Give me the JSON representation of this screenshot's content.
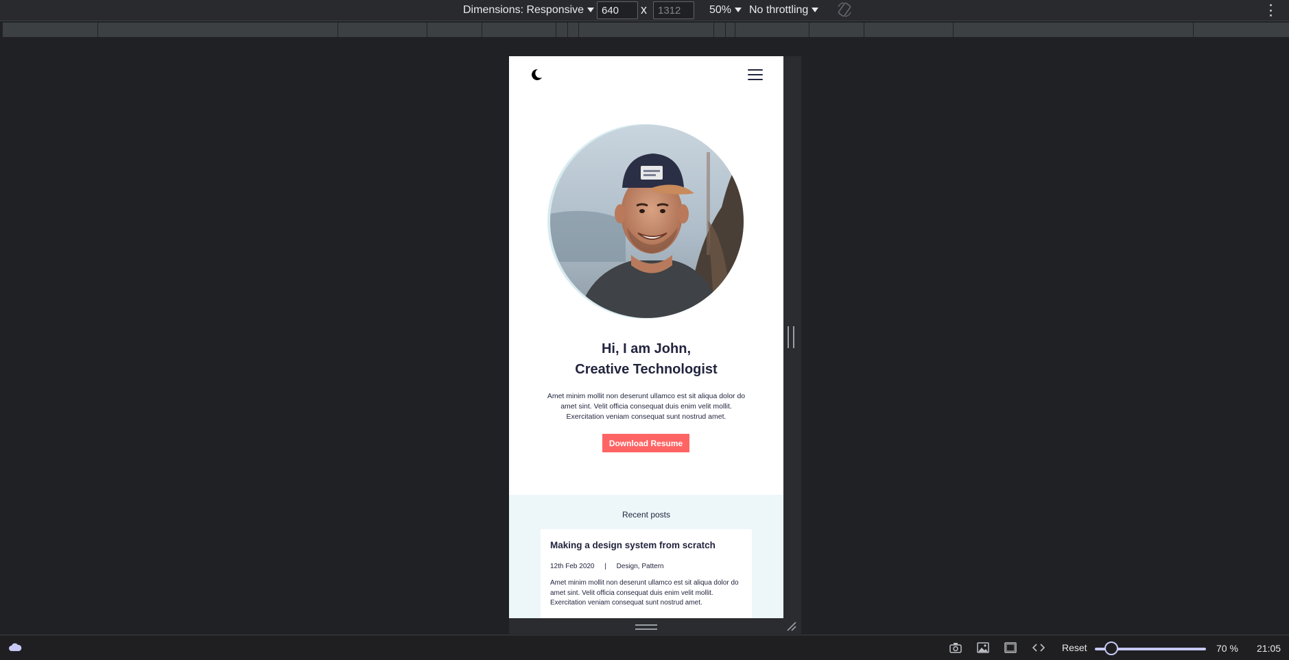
{
  "toolbar": {
    "dimensions_label": "Dimensions: Responsive",
    "width_value": "640",
    "times": "x",
    "height_placeholder": "1312",
    "zoom_label": "50%",
    "throttling_label": "No throttling"
  },
  "site": {
    "hero_title_line1": "Hi, I am John,",
    "hero_title_line2": "Creative Technologist",
    "hero_description": "Amet minim mollit non deserunt ullamco est sit aliqua dolor do amet sint. Velit officia consequat duis enim velit mollit. Exercitation veniam consequat sunt nostrud amet.",
    "cta_label": "Download Resume",
    "recent_posts_title": "Recent posts",
    "post": {
      "title": "Making a design system from scratch",
      "date": "12th Feb 2020",
      "separator": "|",
      "tags": "Design, Pattern",
      "excerpt": "Amet minim mollit non deserunt ullamco est sit aliqua dolor do amet sint. Velit officia consequat duis enim velit mollit. Exercitation veniam consequat sunt nostrud amet."
    }
  },
  "statusbar": {
    "reset_label": "Reset",
    "zoom_value": "70 %",
    "zoom_slider_fraction": 0.1,
    "time": "21:05"
  },
  "colors": {
    "accent": "#ff6464",
    "recent_bg": "#edf7fa",
    "text_dark": "#21243d"
  },
  "icons": [
    "moon-icon",
    "hamburger-icon",
    "rotate-icon",
    "more-icon",
    "cloud-icon",
    "camera-icon",
    "image-icon",
    "frame-icon",
    "code-icon"
  ]
}
